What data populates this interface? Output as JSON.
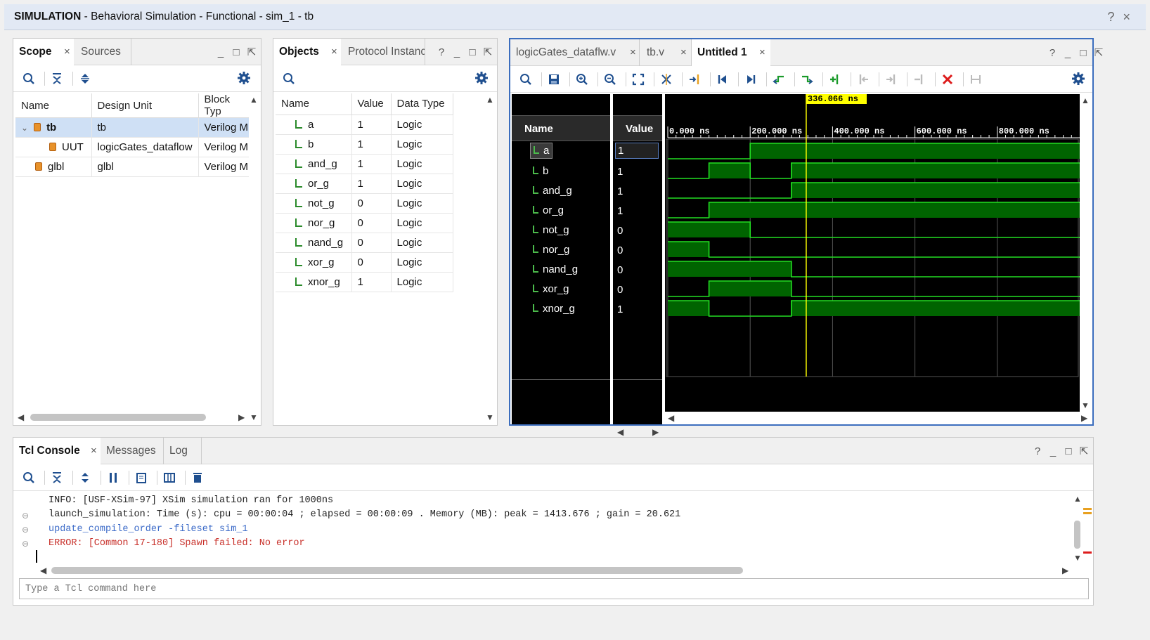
{
  "window": {
    "title_bold": "SIMULATION",
    "title_rest": " - Behavioral Simulation - Functional - sim_1 - tb",
    "help": "?",
    "close": "×"
  },
  "scope_panel": {
    "tabs": [
      {
        "label": "Scope",
        "active": true
      },
      {
        "label": "Sources",
        "active": false
      }
    ],
    "columns": [
      "Name",
      "Design Unit",
      "Block Typ"
    ],
    "rows": [
      {
        "name": "tb",
        "unit": "tb",
        "type": "Verilog M",
        "selected": true,
        "expanded": true
      },
      {
        "name": "UUT",
        "unit": "logicGates_dataflow",
        "type": "Verilog M"
      },
      {
        "name": "glbl",
        "unit": "glbl",
        "type": "Verilog M"
      }
    ]
  },
  "objects_panel": {
    "tabs": [
      {
        "label": "Objects",
        "active": true
      },
      {
        "label": "Protocol Instanc",
        "active": false
      }
    ],
    "help": "?",
    "columns": [
      "Name",
      "Value",
      "Data Type"
    ],
    "rows": [
      {
        "name": "a",
        "value": "1",
        "type": "Logic"
      },
      {
        "name": "b",
        "value": "1",
        "type": "Logic"
      },
      {
        "name": "and_g",
        "value": "1",
        "type": "Logic"
      },
      {
        "name": "or_g",
        "value": "1",
        "type": "Logic"
      },
      {
        "name": "not_g",
        "value": "0",
        "type": "Logic"
      },
      {
        "name": "nor_g",
        "value": "0",
        "type": "Logic"
      },
      {
        "name": "nand_g",
        "value": "0",
        "type": "Logic"
      },
      {
        "name": "xor_g",
        "value": "0",
        "type": "Logic"
      },
      {
        "name": "xnor_g",
        "value": "1",
        "type": "Logic"
      }
    ]
  },
  "wave_panel": {
    "tabs": [
      {
        "label": "logicGates_dataflw.v",
        "active": false
      },
      {
        "label": "tb.v",
        "active": false
      },
      {
        "label": "Untitled 1",
        "active": true
      }
    ],
    "help": "?",
    "name_header": "Name",
    "value_header": "Value",
    "cursor_label": "336.066 ns",
    "cursor_time_ns": 336.066,
    "time_range_ns": [
      0,
      1000
    ],
    "time_ticks": [
      "0.000 ns",
      "200.000 ns",
      "400.000 ns",
      "600.000 ns",
      "800.000 ns"
    ],
    "signals": [
      {
        "name": "a",
        "value": "1",
        "transitions": [
          [
            0,
            0
          ],
          [
            200,
            1
          ]
        ]
      },
      {
        "name": "b",
        "value": "1",
        "transitions": [
          [
            0,
            0
          ],
          [
            100,
            1
          ],
          [
            200,
            0
          ],
          [
            300,
            1
          ]
        ]
      },
      {
        "name": "and_g",
        "value": "1",
        "transitions": [
          [
            0,
            0
          ],
          [
            300,
            1
          ]
        ]
      },
      {
        "name": "or_g",
        "value": "1",
        "transitions": [
          [
            0,
            0
          ],
          [
            100,
            1
          ]
        ]
      },
      {
        "name": "not_g",
        "value": "0",
        "transitions": [
          [
            0,
            1
          ],
          [
            200,
            0
          ]
        ]
      },
      {
        "name": "nor_g",
        "value": "0",
        "transitions": [
          [
            0,
            1
          ],
          [
            100,
            0
          ]
        ]
      },
      {
        "name": "nand_g",
        "value": "0",
        "transitions": [
          [
            0,
            1
          ],
          [
            300,
            0
          ]
        ]
      },
      {
        "name": "xor_g",
        "value": "0",
        "transitions": [
          [
            0,
            0
          ],
          [
            100,
            1
          ],
          [
            300,
            0
          ]
        ]
      },
      {
        "name": "xnor_g",
        "value": "1",
        "transitions": [
          [
            0,
            1
          ],
          [
            100,
            0
          ],
          [
            300,
            1
          ]
        ]
      }
    ]
  },
  "console_panel": {
    "tabs": [
      {
        "label": "Tcl Console",
        "active": true
      },
      {
        "label": "Messages",
        "active": false
      },
      {
        "label": "Log",
        "active": false
      }
    ],
    "help": "?",
    "lines": [
      {
        "text": "INFO: [USF-XSim-97] XSim simulation ran for 1000ns",
        "color": "#222222"
      },
      {
        "text": "launch_simulation: Time (s): cpu = 00:00:04 ; elapsed = 00:00:09 . Memory (MB): peak = 1413.676 ; gain = 20.621",
        "color": "#222222"
      },
      {
        "text": "update_compile_order -fileset sim_1",
        "color": "#3b6ac8"
      },
      {
        "text": "ERROR: [Common 17-180] Spawn failed: No error",
        "color": "#c8302a"
      }
    ],
    "input_placeholder": "Type a Tcl command here"
  },
  "colors": {
    "accent": "#3c6ebe",
    "wave_fill": "#006400",
    "wave_line": "#22dd22",
    "cursor": "#ffff00",
    "error": "#c8302a"
  }
}
